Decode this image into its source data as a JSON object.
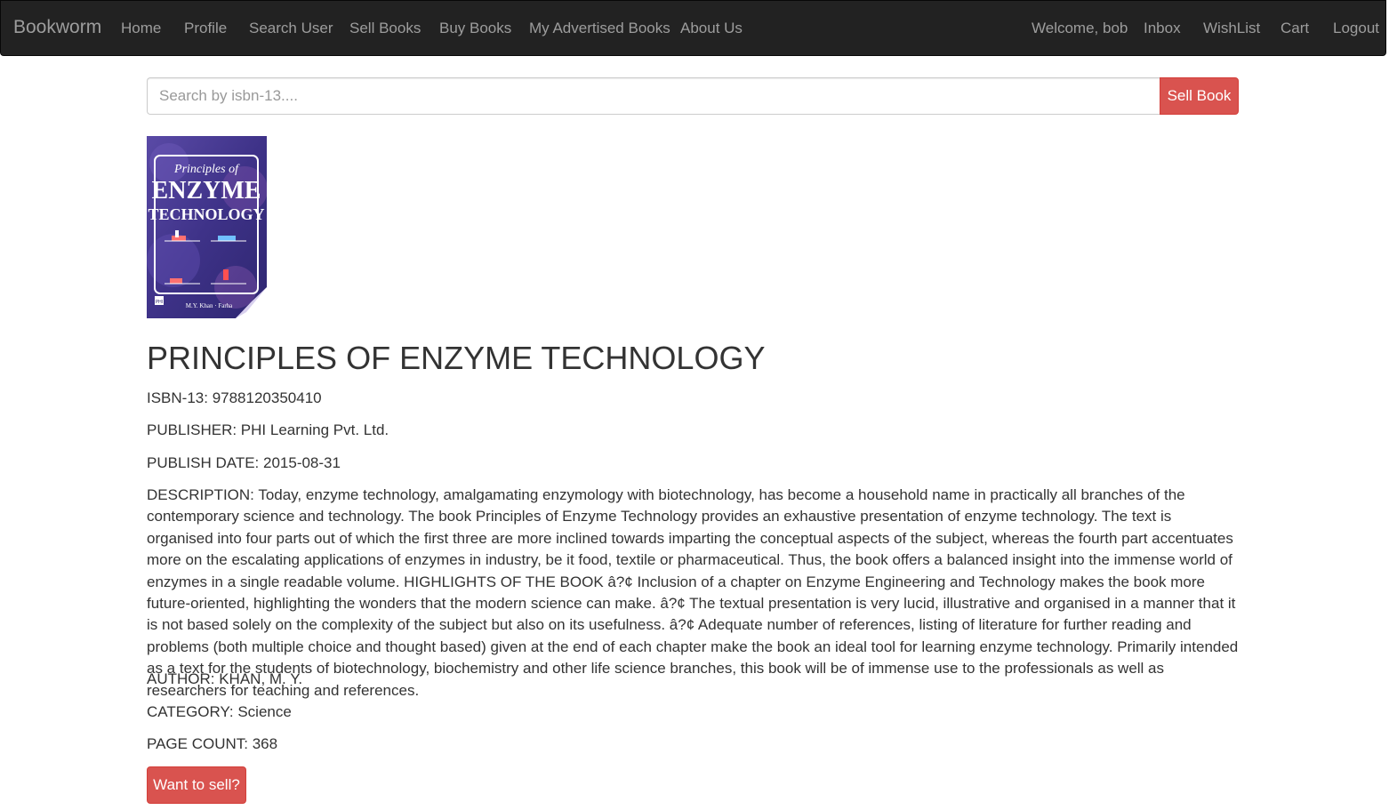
{
  "navbar": {
    "brand": "Bookworm",
    "left_items": [
      "Home",
      "Profile",
      "Search User",
      "Sell Books",
      "Buy Books",
      "My Advertised Books",
      "About Us"
    ],
    "right_items": [
      "Welcome, bob",
      "Inbox",
      "WishList",
      "Cart",
      "Logout"
    ]
  },
  "search": {
    "placeholder": "Search by isbn-13....",
    "value": "",
    "button_label": "Sell Book"
  },
  "cover": {
    "line1": "Principles of",
    "line2": "ENZYME",
    "line3": "TECHNOLOGY",
    "authors": "M.Y. Khan · Farha",
    "publisher_mark": "PHI"
  },
  "book": {
    "title": "PRINCIPLES OF ENZYME TECHNOLOGY",
    "isbn": "ISBN-13: 9788120350410",
    "publisher": "PUBLISHER: PHI Learning Pvt. Ltd.",
    "publish_date": "PUBLISH DATE: 2015-08-31",
    "description": "DESCRIPTION: Today, enzyme technology, amalgamating enzymology with biotechnology, has become a household name in practically all branches of the contemporary science and technology. The book Principles of Enzyme Technology provides an exhaustive presentation of enzyme technology. The text is organised into four parts out of which the first three are more inclined towards imparting the conceptual aspects of the subject, whereas the fourth part accentuates more on the escalating applications of enzymes in industry, be it food, textile or pharmaceutical. Thus, the book offers a balanced insight into the immense world of enzymes in a single readable volume. HIGHLIGHTS OF THE BOOK â?¢ Inclusion of a chapter on Enzyme Engineering and Technology makes the book more future-oriented, highlighting the wonders that the modern science can make. â?¢ The textual presentation is very lucid, illustrative and organised in a manner that it is not based solely on the complexity of the subject but also on its usefulness. â?¢ Adequate number of references, listing of literature for further reading and problems (both multiple choice and thought based) given at the end of each chapter make the book an ideal tool for learning enzyme technology. Primarily intended as a text for the students of biotechnology, biochemistry and other life science branches, this book will be of immense use to the professionals as well as researchers for teaching and references.",
    "author": "AUTHOR: KHAN, M. Y.",
    "category": "CATEGORY: Science",
    "page_count": "PAGE COUNT: 368"
  },
  "actions": {
    "want_to_sell": "Want to sell?"
  },
  "colors": {
    "navbar_bg": "#222222",
    "nav_text": "#9d9d9d",
    "danger": "#d9534f",
    "cover_purple": "#4a3e8f"
  }
}
